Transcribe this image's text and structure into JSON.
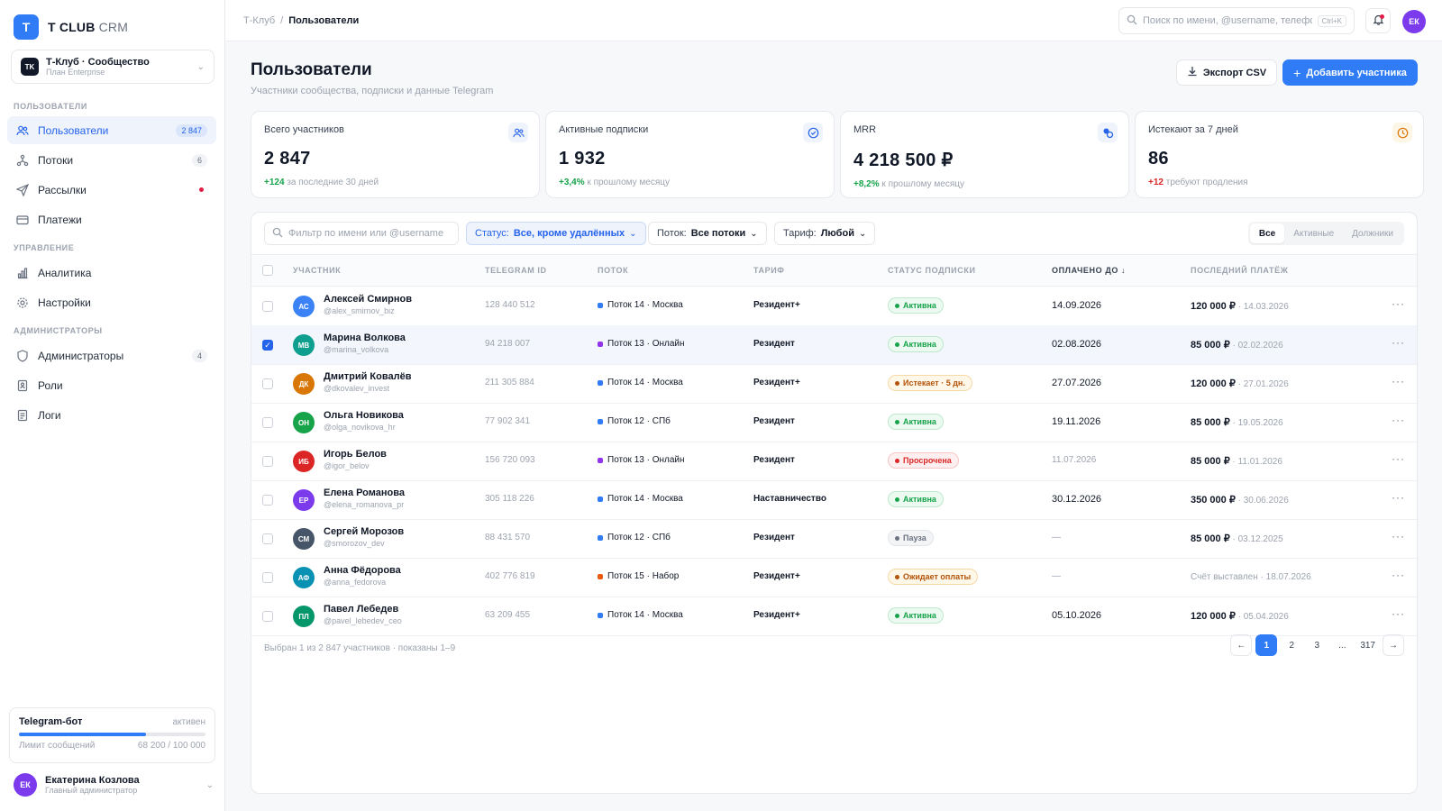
{
  "brand": {
    "logo": "T",
    "name": "T CLUB",
    "suffix": " CRM"
  },
  "workspace": {
    "badge": "TK",
    "name": "Т-Клуб · Сообщество",
    "plan": "План Enterprise"
  },
  "nav": {
    "section_users": "ПОЛЬЗОВАТЕЛИ",
    "section_manage": "УПРАВЛЕНИЕ",
    "section_admins": "АДМИНИСТРАТОРЫ",
    "items": [
      {
        "label": "Пользователи",
        "count": "2 847",
        "icon": "users-icon"
      },
      {
        "label": "Потоки",
        "count": "6",
        "icon": "streams-icon"
      },
      {
        "label": "Рассылки",
        "count": "",
        "icon": "send-icon"
      },
      {
        "label": "Платежи",
        "count": "",
        "icon": "card-icon"
      },
      {
        "label": "Аналитика",
        "count": "",
        "icon": "chart-icon"
      },
      {
        "label": "Настройки",
        "count": "",
        "icon": "gear-icon"
      },
      {
        "label": "Администраторы",
        "count": "4",
        "icon": "shield-icon"
      },
      {
        "label": "Роли",
        "count": "",
        "icon": "badge-icon"
      },
      {
        "label": "Логи",
        "count": "",
        "icon": "log-icon"
      }
    ]
  },
  "bot": {
    "title": "Telegram-бот",
    "state": "активен",
    "limit_label": "Лимит сообщений",
    "limit_value": "68 200 / 100 000",
    "usage_fraction": 0.682
  },
  "current_user": {
    "initials": "ЕК",
    "name": "Екатерина Козлова",
    "role": "Главный администратор"
  },
  "topbar": {
    "crumb_root": "Т-Клуб",
    "crumb_sep": "/",
    "crumb_current": "Пользователи",
    "search_placeholder": "Поиск по имени, @username, телефону...",
    "search_shortcut": "Ctrl+K",
    "avatar": "ЕК"
  },
  "header": {
    "title": "Пользователи",
    "subtitle": "Участники сообщества, подписки и данные Telegram",
    "export_label": "Экспорт CSV",
    "add_label": "Добавить участника"
  },
  "stats": [
    {
      "label": "Всего участников",
      "value": "2 847",
      "delta": "+124",
      "delta_note": "за последние 30 дней"
    },
    {
      "label": "Активные подписки",
      "value": "1 932",
      "delta": "+3,4%",
      "delta_note": "к прошлому месяцу"
    },
    {
      "label": "MRR",
      "value": "4 218 500 ₽",
      "delta": "+8,2%",
      "delta_note": "к прошлому месяцу"
    },
    {
      "label": "Истекают за 7 дней",
      "value": "86",
      "delta": "+12",
      "delta_note": "требуют продления"
    }
  ],
  "filters": {
    "search_placeholder": "Фильтр по имени или @username",
    "status_key": "Статус:",
    "status_value": "Все, кроме удалённых",
    "stream_key": "Поток:",
    "stream_value": "Все потоки",
    "tariff_key": "Тариф:",
    "tariff_value": "Любой",
    "segments": [
      "Все",
      "Активные",
      "Должники"
    ]
  },
  "columns": {
    "member": "УЧАСТНИК",
    "tgid": "TELEGRAM ID",
    "stream": "ПОТОК",
    "tariff": "ТАРИФ",
    "status": "СТАТУС ПОДПИСКИ",
    "paid": "ОПЛАЧЕНО ДО ↓",
    "last": "ПОСЛЕДНИЙ ПЛАТЁЖ"
  },
  "rows": [
    {
      "initials": "АС",
      "color": "#3b82f6",
      "name": "Алексей Смирнов",
      "username": "@alex_smirnov_biz",
      "tgid": "128 440 512",
      "stream": "Поток 14 · Москва",
      "stream_color": "#2f7cf6",
      "tariff": "Резидент+",
      "status": "Активна",
      "status_kind": "active",
      "paid": "14.09.2026",
      "amount": "120 000 ₽",
      "last_date": " · 14.03.2026",
      "selected": false
    },
    {
      "initials": "МВ",
      "color": "#0e9f8f",
      "name": "Марина Волкова",
      "username": "@marina_volkova",
      "tgid": "94 218 007",
      "stream": "Поток 13 · Онлайн",
      "stream_color": "#9333ea",
      "tariff": "Резидент",
      "status": "Активна",
      "status_kind": "active",
      "paid": "02.08.2026",
      "amount": "85 000 ₽",
      "last_date": " · 02.02.2026",
      "selected": true
    },
    {
      "initials": "ДК",
      "color": "#d97706",
      "name": "Дмитрий Ковалёв",
      "username": "@dkovalev_invest",
      "tgid": "211 305 884",
      "stream": "Поток 14 · Москва",
      "stream_color": "#2f7cf6",
      "tariff": "Резидент+",
      "status": "Истекает · 5 дн.",
      "status_kind": "expiring",
      "paid": "27.07.2026",
      "amount": "120 000 ₽",
      "last_date": " · 27.01.2026",
      "selected": false
    },
    {
      "initials": "ОН",
      "color": "#16a34a",
      "name": "Ольга Новикова",
      "username": "@olga_novikova_hr",
      "tgid": "77 902 341",
      "stream": "Поток 12 · СПб",
      "stream_color": "#2f7cf6",
      "tariff": "Резидент",
      "status": "Активна",
      "status_kind": "active",
      "paid": "19.11.2026",
      "amount": "85 000 ₽",
      "last_date": " · 19.05.2026",
      "selected": false
    },
    {
      "initials": "ИБ",
      "color": "#dc2626",
      "name": "Игорь Белов",
      "username": "@igor_belov",
      "tgid": "156 720 093",
      "stream": "Поток 13 · Онлайн",
      "stream_color": "#9333ea",
      "tariff": "Резидент",
      "status": "Просрочена",
      "status_kind": "overdue",
      "paid": "11.07.2026",
      "paid_muted": true,
      "amount": "85 000 ₽",
      "last_date": " · 11.01.2026",
      "selected": false
    },
    {
      "initials": "ЕР",
      "color": "#7c3aed",
      "name": "Елена Романова",
      "username": "@elena_romanova_pr",
      "tgid": "305 118 226",
      "stream": "Поток 14 · Москва",
      "stream_color": "#2f7cf6",
      "tariff": "Наставничество",
      "status": "Активна",
      "status_kind": "active",
      "paid": "30.12.2026",
      "amount": "350 000 ₽",
      "last_date": " · 30.06.2026",
      "selected": false
    },
    {
      "initials": "СМ",
      "color": "#475569",
      "name": "Сергей Морозов",
      "username": "@smorozov_dev",
      "tgid": "88 431 570",
      "stream": "Поток 12 · СПб",
      "stream_color": "#2f7cf6",
      "tariff": "Резидент",
      "status": "Пауза",
      "status_kind": "paused",
      "paid": "—",
      "paid_muted": true,
      "amount": "85 000 ₽",
      "last_date": " · 03.12.2025",
      "selected": false
    },
    {
      "initials": "АФ",
      "color": "#0891b2",
      "name": "Анна Фёдорова",
      "username": "@anna_fedorova",
      "tgid": "402 776 819",
      "stream": "Поток 15 · Набор",
      "stream_color": "#ea580c",
      "tariff": "Резидент+",
      "status": "Ожидает оплаты",
      "status_kind": "pending",
      "paid": "—",
      "paid_muted": true,
      "amount": "",
      "last_date": "Счёт выставлен · 18.07.2026",
      "selected": false
    },
    {
      "initials": "ПЛ",
      "color": "#059669",
      "name": "Павел Лебедев",
      "username": "@pavel_lebedev_ceo",
      "tgid": "63 209 455",
      "stream": "Поток 14 · Москва",
      "stream_color": "#2f7cf6",
      "tariff": "Резидент+",
      "status": "Активна",
      "status_kind": "active",
      "paid": "05.10.2026",
      "amount": "120 000 ₽",
      "last_date": " · 05.04.2026",
      "selected": false
    }
  ],
  "footer": {
    "summary": "Выбран 1 из 2 847 участников · показаны 1–9"
  },
  "pagination": {
    "prev": "←",
    "pages": [
      "1",
      "2",
      "3",
      "...",
      "317"
    ],
    "next": "→",
    "current": "1"
  },
  "colors": {
    "accent": "#2f7cf6",
    "active": "#16a34a",
    "expiring": "#d97706",
    "overdue": "#dc2626",
    "paused": "#6b7280"
  }
}
